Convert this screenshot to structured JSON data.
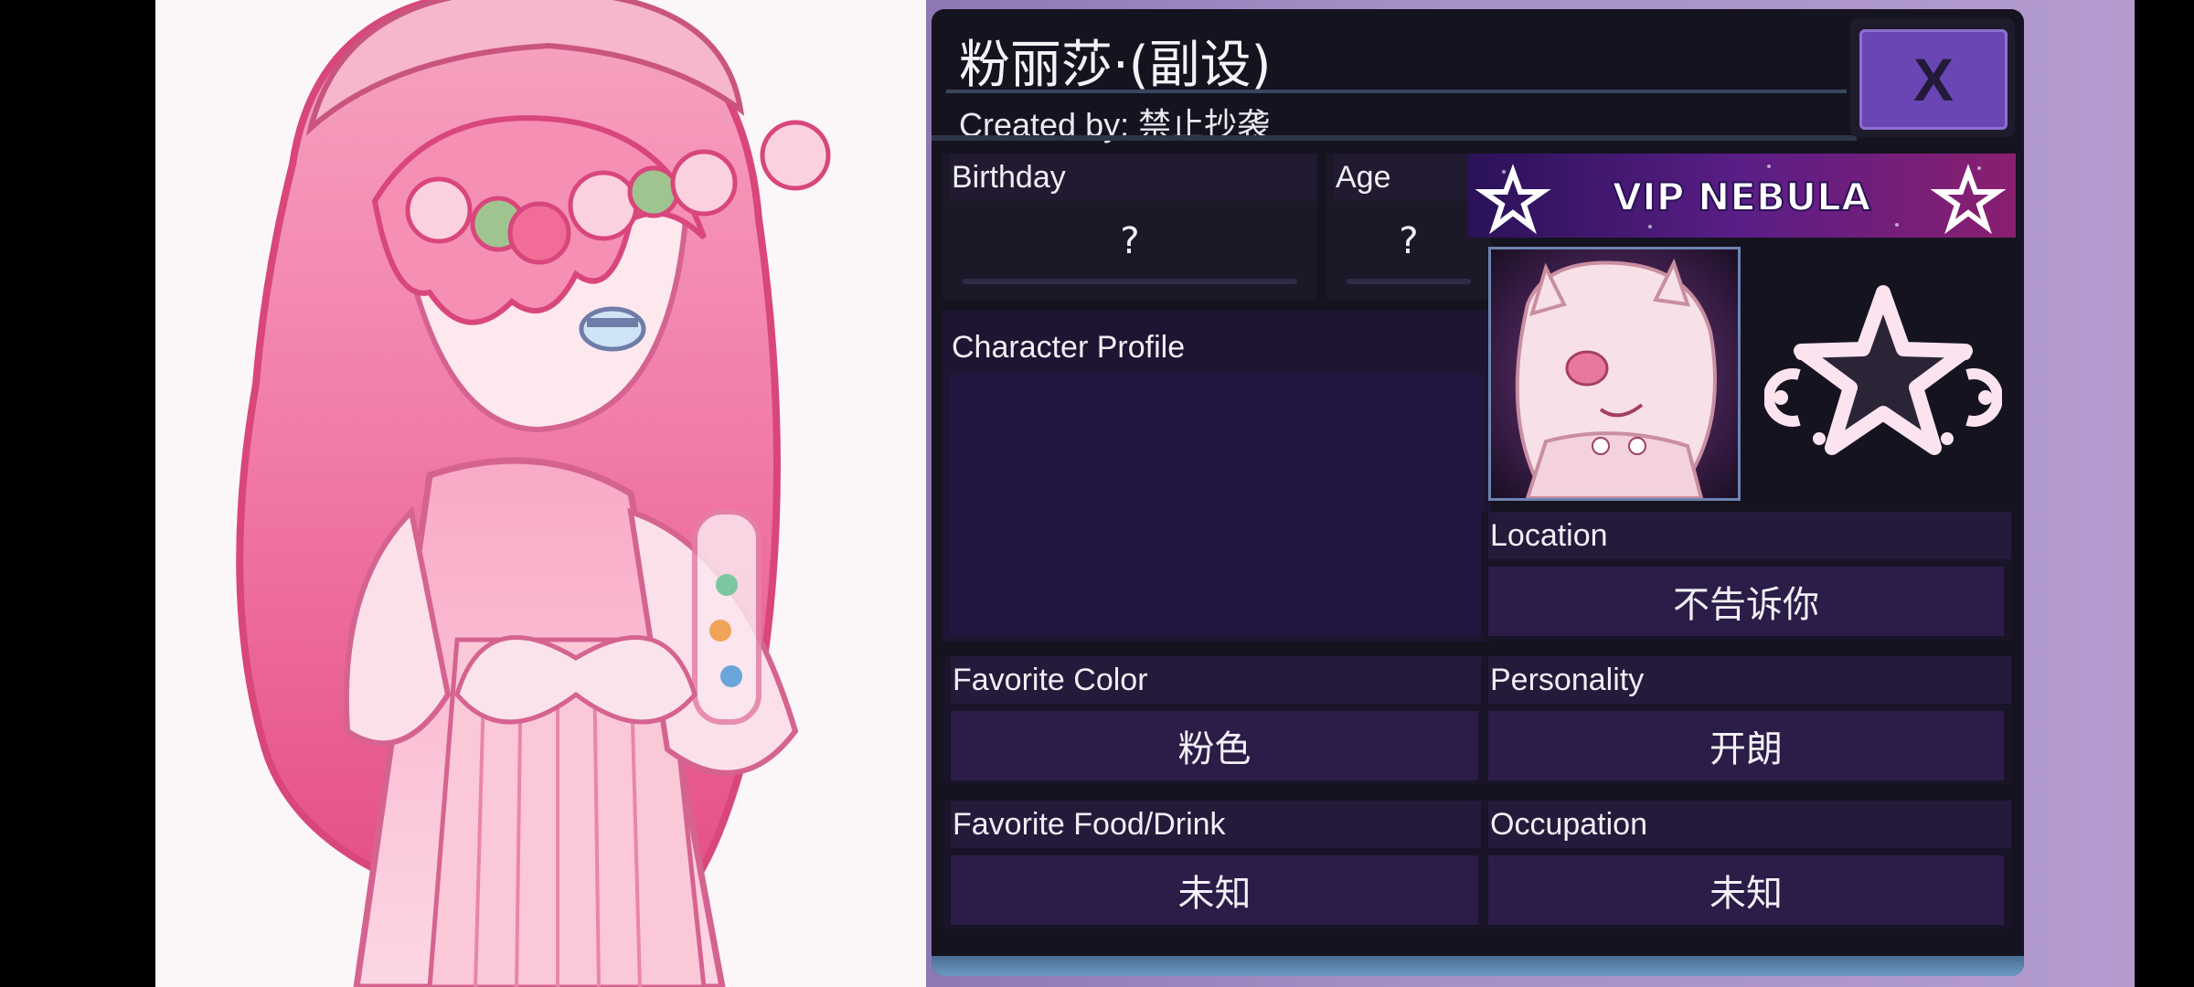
{
  "character": {
    "name": "粉丽莎·(副设)",
    "creator": "Created by: 禁止抄袭"
  },
  "close_button": {
    "label": "X"
  },
  "fields": {
    "birthday": {
      "label": "Birthday",
      "value": "?"
    },
    "age": {
      "label": "Age",
      "value": "?"
    },
    "profile": {
      "label": "Character Profile"
    },
    "location": {
      "label": "Location",
      "value": "不告诉你"
    },
    "favorite_color": {
      "label": "Favorite Color",
      "value": "粉色"
    },
    "personality": {
      "label": "Personality",
      "value": "开朗"
    },
    "favorite_food": {
      "label": "Favorite Food/Drink",
      "value": "未知"
    },
    "occupation": {
      "label": "Occupation",
      "value": "未知"
    }
  },
  "vip_banner": {
    "text": "VIP NEBULA"
  },
  "colors": {
    "panel": "#15131f",
    "accent": "#6a46b4",
    "field": "#2b1c48",
    "pink": "#f06a9c"
  }
}
